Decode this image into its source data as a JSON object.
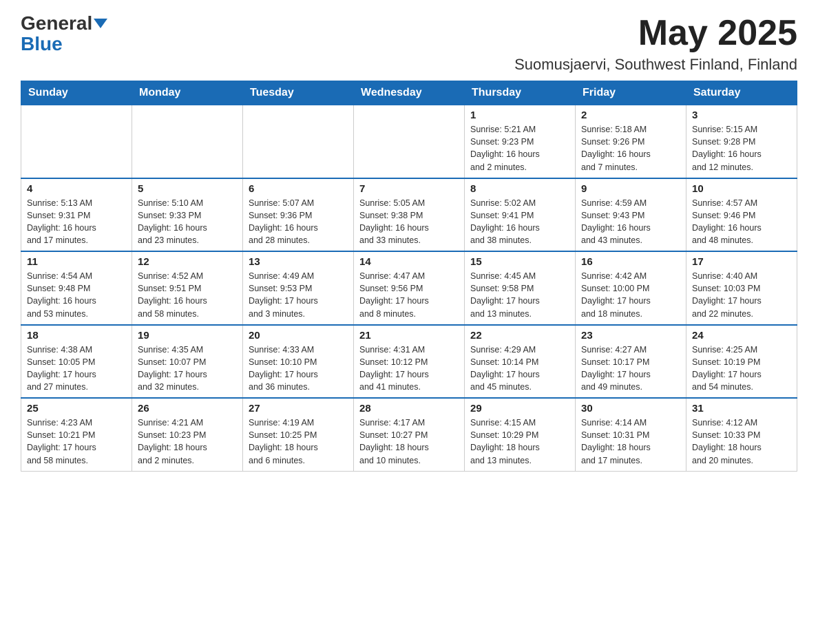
{
  "logo": {
    "text1": "General",
    "text2": "Blue"
  },
  "header": {
    "month": "May 2025",
    "location": "Suomusjaervi, Southwest Finland, Finland"
  },
  "weekdays": [
    "Sunday",
    "Monday",
    "Tuesday",
    "Wednesday",
    "Thursday",
    "Friday",
    "Saturday"
  ],
  "weeks": [
    [
      {
        "day": "",
        "info": ""
      },
      {
        "day": "",
        "info": ""
      },
      {
        "day": "",
        "info": ""
      },
      {
        "day": "",
        "info": ""
      },
      {
        "day": "1",
        "info": "Sunrise: 5:21 AM\nSunset: 9:23 PM\nDaylight: 16 hours\nand 2 minutes."
      },
      {
        "day": "2",
        "info": "Sunrise: 5:18 AM\nSunset: 9:26 PM\nDaylight: 16 hours\nand 7 minutes."
      },
      {
        "day": "3",
        "info": "Sunrise: 5:15 AM\nSunset: 9:28 PM\nDaylight: 16 hours\nand 12 minutes."
      }
    ],
    [
      {
        "day": "4",
        "info": "Sunrise: 5:13 AM\nSunset: 9:31 PM\nDaylight: 16 hours\nand 17 minutes."
      },
      {
        "day": "5",
        "info": "Sunrise: 5:10 AM\nSunset: 9:33 PM\nDaylight: 16 hours\nand 23 minutes."
      },
      {
        "day": "6",
        "info": "Sunrise: 5:07 AM\nSunset: 9:36 PM\nDaylight: 16 hours\nand 28 minutes."
      },
      {
        "day": "7",
        "info": "Sunrise: 5:05 AM\nSunset: 9:38 PM\nDaylight: 16 hours\nand 33 minutes."
      },
      {
        "day": "8",
        "info": "Sunrise: 5:02 AM\nSunset: 9:41 PM\nDaylight: 16 hours\nand 38 minutes."
      },
      {
        "day": "9",
        "info": "Sunrise: 4:59 AM\nSunset: 9:43 PM\nDaylight: 16 hours\nand 43 minutes."
      },
      {
        "day": "10",
        "info": "Sunrise: 4:57 AM\nSunset: 9:46 PM\nDaylight: 16 hours\nand 48 minutes."
      }
    ],
    [
      {
        "day": "11",
        "info": "Sunrise: 4:54 AM\nSunset: 9:48 PM\nDaylight: 16 hours\nand 53 minutes."
      },
      {
        "day": "12",
        "info": "Sunrise: 4:52 AM\nSunset: 9:51 PM\nDaylight: 16 hours\nand 58 minutes."
      },
      {
        "day": "13",
        "info": "Sunrise: 4:49 AM\nSunset: 9:53 PM\nDaylight: 17 hours\nand 3 minutes."
      },
      {
        "day": "14",
        "info": "Sunrise: 4:47 AM\nSunset: 9:56 PM\nDaylight: 17 hours\nand 8 minutes."
      },
      {
        "day": "15",
        "info": "Sunrise: 4:45 AM\nSunset: 9:58 PM\nDaylight: 17 hours\nand 13 minutes."
      },
      {
        "day": "16",
        "info": "Sunrise: 4:42 AM\nSunset: 10:00 PM\nDaylight: 17 hours\nand 18 minutes."
      },
      {
        "day": "17",
        "info": "Sunrise: 4:40 AM\nSunset: 10:03 PM\nDaylight: 17 hours\nand 22 minutes."
      }
    ],
    [
      {
        "day": "18",
        "info": "Sunrise: 4:38 AM\nSunset: 10:05 PM\nDaylight: 17 hours\nand 27 minutes."
      },
      {
        "day": "19",
        "info": "Sunrise: 4:35 AM\nSunset: 10:07 PM\nDaylight: 17 hours\nand 32 minutes."
      },
      {
        "day": "20",
        "info": "Sunrise: 4:33 AM\nSunset: 10:10 PM\nDaylight: 17 hours\nand 36 minutes."
      },
      {
        "day": "21",
        "info": "Sunrise: 4:31 AM\nSunset: 10:12 PM\nDaylight: 17 hours\nand 41 minutes."
      },
      {
        "day": "22",
        "info": "Sunrise: 4:29 AM\nSunset: 10:14 PM\nDaylight: 17 hours\nand 45 minutes."
      },
      {
        "day": "23",
        "info": "Sunrise: 4:27 AM\nSunset: 10:17 PM\nDaylight: 17 hours\nand 49 minutes."
      },
      {
        "day": "24",
        "info": "Sunrise: 4:25 AM\nSunset: 10:19 PM\nDaylight: 17 hours\nand 54 minutes."
      }
    ],
    [
      {
        "day": "25",
        "info": "Sunrise: 4:23 AM\nSunset: 10:21 PM\nDaylight: 17 hours\nand 58 minutes."
      },
      {
        "day": "26",
        "info": "Sunrise: 4:21 AM\nSunset: 10:23 PM\nDaylight: 18 hours\nand 2 minutes."
      },
      {
        "day": "27",
        "info": "Sunrise: 4:19 AM\nSunset: 10:25 PM\nDaylight: 18 hours\nand 6 minutes."
      },
      {
        "day": "28",
        "info": "Sunrise: 4:17 AM\nSunset: 10:27 PM\nDaylight: 18 hours\nand 10 minutes."
      },
      {
        "day": "29",
        "info": "Sunrise: 4:15 AM\nSunset: 10:29 PM\nDaylight: 18 hours\nand 13 minutes."
      },
      {
        "day": "30",
        "info": "Sunrise: 4:14 AM\nSunset: 10:31 PM\nDaylight: 18 hours\nand 17 minutes."
      },
      {
        "day": "31",
        "info": "Sunrise: 4:12 AM\nSunset: 10:33 PM\nDaylight: 18 hours\nand 20 minutes."
      }
    ]
  ]
}
